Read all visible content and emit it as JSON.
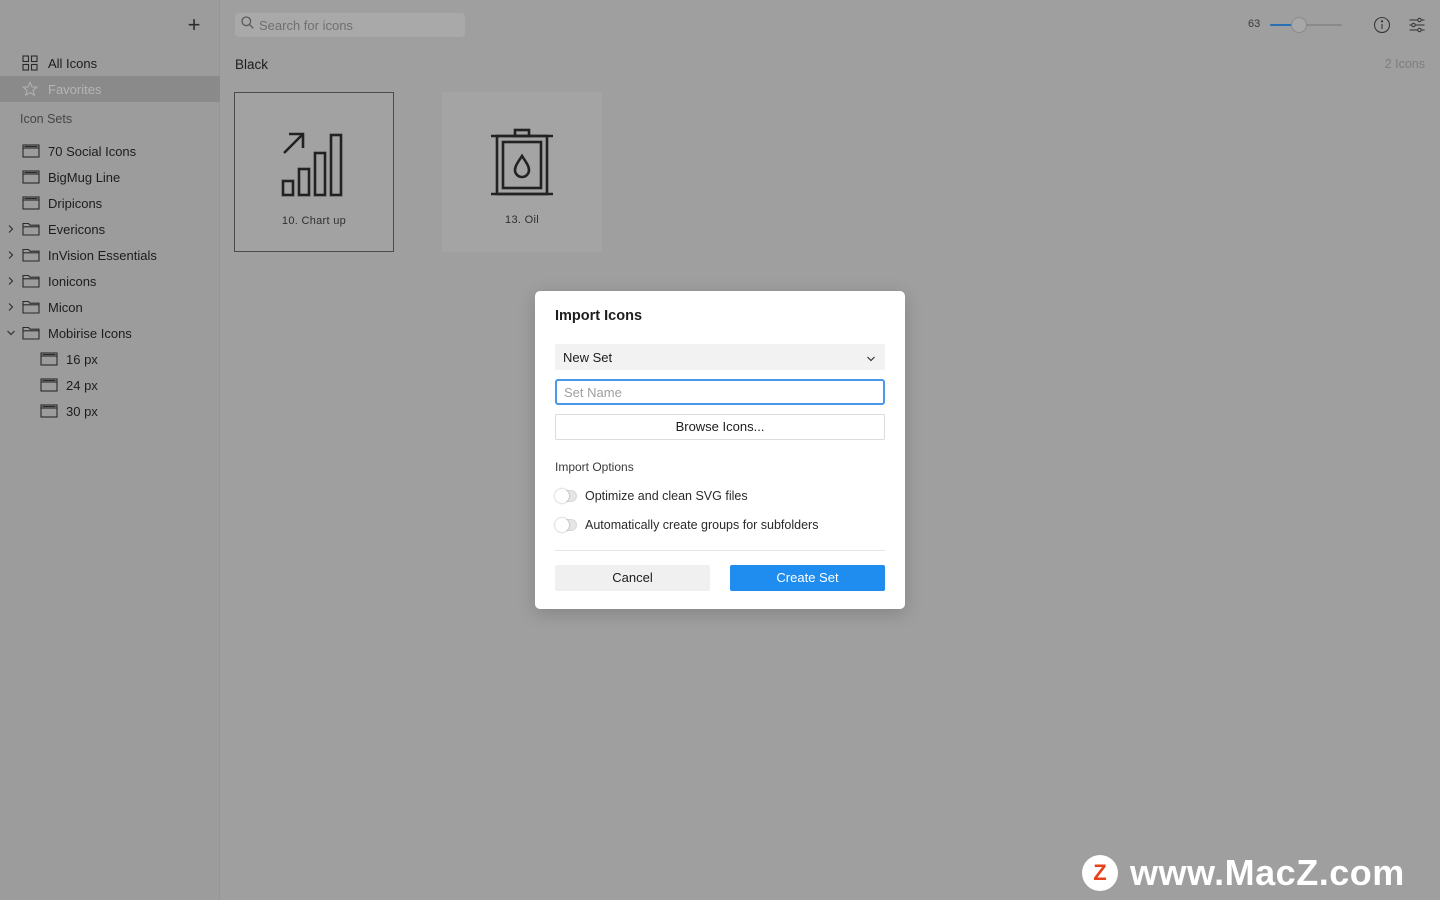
{
  "colors": {
    "accent": "#1f8cf0",
    "focus_ring": "#4a98e9",
    "overlay_background": "#9f9f9f",
    "watermark_logo": "#e8421b"
  },
  "sidebar": {
    "add_button": "+",
    "nav": [
      {
        "label": "All Icons",
        "icon": "grid-icon",
        "selected": false
      },
      {
        "label": "Favorites",
        "icon": "star-icon",
        "selected": true
      }
    ],
    "section_label": "Icon Sets",
    "sets": [
      {
        "label": "70 Social Icons",
        "icon": "archive-icon",
        "expandable": false,
        "expanded": false,
        "level": 0
      },
      {
        "label": "BigMug Line",
        "icon": "archive-icon",
        "expandable": false,
        "expanded": false,
        "level": 0
      },
      {
        "label": "Dripicons",
        "icon": "archive-icon",
        "expandable": false,
        "expanded": false,
        "level": 0
      },
      {
        "label": "Evericons",
        "icon": "folder-icon",
        "expandable": true,
        "expanded": false,
        "level": 0
      },
      {
        "label": "InVision Essentials",
        "icon": "folder-icon",
        "expandable": true,
        "expanded": false,
        "level": 0
      },
      {
        "label": "Ionicons",
        "icon": "folder-icon",
        "expandable": true,
        "expanded": false,
        "level": 0
      },
      {
        "label": "Micon",
        "icon": "folder-icon",
        "expandable": true,
        "expanded": false,
        "level": 0
      },
      {
        "label": "Mobirise Icons",
        "icon": "folder-icon",
        "expandable": true,
        "expanded": true,
        "level": 0
      },
      {
        "label": "16 px",
        "icon": "archive-icon",
        "expandable": false,
        "expanded": false,
        "level": 1
      },
      {
        "label": "24 px",
        "icon": "archive-icon",
        "expandable": false,
        "expanded": false,
        "level": 1
      },
      {
        "label": "30 px",
        "icon": "archive-icon",
        "expandable": false,
        "expanded": false,
        "level": 1
      }
    ]
  },
  "toolbar": {
    "search_placeholder": "Search for icons",
    "zoom_value": "63",
    "zoom_fraction": 0.4,
    "info_icon": "info-icon",
    "settings_icon": "sliders-icon"
  },
  "content": {
    "set_title": "Black",
    "icon_count": "2 Icons",
    "icons": [
      {
        "label": "10. Chart up",
        "icon": "chart-up-icon",
        "selected": true
      },
      {
        "label": "13. Oil",
        "icon": "oil-barrel-icon",
        "selected": false
      }
    ]
  },
  "dialog": {
    "title": "Import Icons",
    "select_value": "New Set",
    "name_placeholder": "Set Name",
    "browse_label": "Browse Icons...",
    "options_label": "Import Options",
    "options": [
      {
        "label": "Optimize and clean SVG files",
        "on": false
      },
      {
        "label": "Automatically create groups for subfolders",
        "on": false
      }
    ],
    "cancel_label": "Cancel",
    "create_label": "Create Set"
  },
  "watermark": {
    "logo_letter": "Z",
    "text": "www.MacZ.com"
  }
}
